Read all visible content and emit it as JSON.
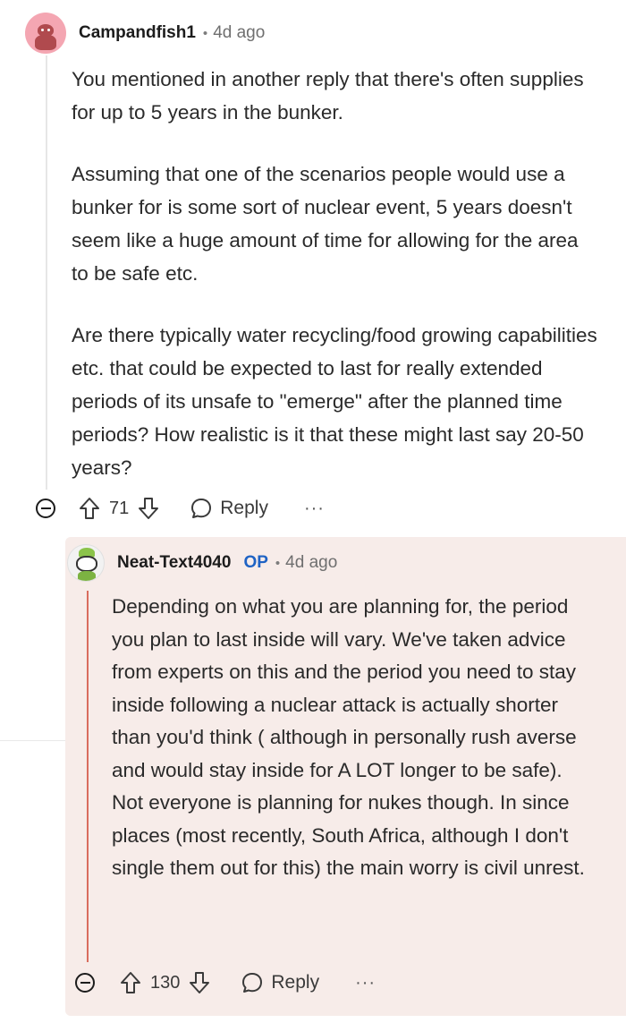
{
  "comment": {
    "username": "Campandfish1",
    "time": "4d ago",
    "paragraphs": [
      "You mentioned in another reply that there's often supplies for up to 5 years in the bunker.",
      "Assuming that one of the scenarios people would use a bunker for is some sort of nuclear event, 5 years doesn't seem like a huge amount of time for allowing for the area to be safe etc.",
      "Are there typically water recycling/food growing capabilities etc. that could be expected to last for really extended periods of its unsafe to \"emerge\" after the planned time periods? How realistic is it that these might last say 20-50 years?"
    ],
    "votes": "71",
    "reply_label": "Reply",
    "more_label": "···"
  },
  "reply": {
    "username": "Neat-Text4040",
    "op_badge": "OP",
    "time": "4d ago",
    "text": "Depending on what you are planning for, the period you plan to last inside will vary. We've taken advice from experts on this and the period you need to stay inside following a nuclear attack is actually shorter than you'd think ( although in personally rush averse and would stay inside for A LOT longer to be safe). Not everyone is planning for nukes though. In since places (most recently, South Africa, although I don't single them out for this) the main worry is civil unrest.",
    "votes": "130",
    "reply_label": "Reply",
    "more_label": "···"
  },
  "colors": {
    "op_badge": "#1f63c4",
    "reply_background": "#f7ece9",
    "reply_thread_line": "#d96d5e",
    "avatar_background": "#f4a6b2"
  },
  "icons": [
    "collapse-icon",
    "upvote-icon",
    "downvote-icon",
    "comment-bubble-icon",
    "more-options-icon"
  ]
}
